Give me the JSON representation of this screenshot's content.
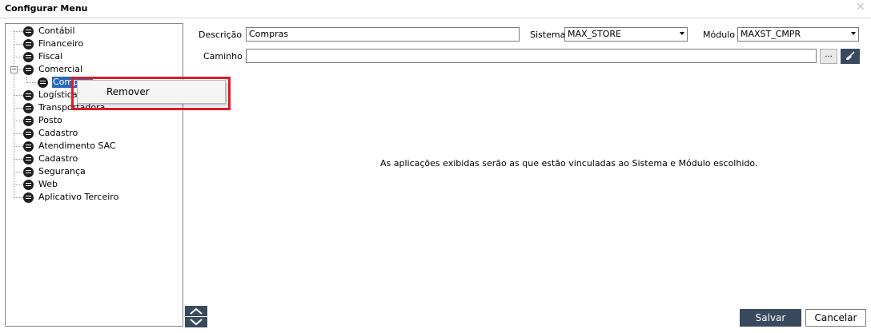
{
  "window": {
    "title": "Configurar Menu",
    "close_icon": "close-icon"
  },
  "tree": {
    "items": [
      {
        "label": "Contábil"
      },
      {
        "label": "Financeiro"
      },
      {
        "label": "Fiscal"
      },
      {
        "label": "Comercial",
        "expanded": true
      },
      {
        "label": "Compras",
        "selected": true
      },
      {
        "label": "Logística"
      },
      {
        "label": "Transportadora"
      },
      {
        "label": "Posto"
      },
      {
        "label": "Cadastro"
      },
      {
        "label": "Atendimento SAC"
      },
      {
        "label": "Cadastro"
      },
      {
        "label": "Segurança"
      },
      {
        "label": "Web"
      },
      {
        "label": "Aplicativo Terceiro"
      }
    ]
  },
  "context_menu": {
    "items": [
      {
        "label": "Remover"
      }
    ],
    "highlight_color": "#e01b24"
  },
  "form": {
    "descricao_label": "Descrição",
    "descricao_value": "Compras",
    "sistema_label": "Sistema",
    "sistema_value": "MAX_STORE",
    "modulo_label": "Módulo",
    "modulo_value": "MAXST_CMPR",
    "caminho_label": "Caminho",
    "caminho_value": "",
    "browse_label": "..."
  },
  "info_text": "As aplicações exibidas serão as que estão vinculadas ao Sistema e Módulo escolhido.",
  "buttons": {
    "save": "Salvar",
    "cancel": "Cancelar"
  },
  "colors": {
    "accent": "#3a4a5e",
    "selection": "#2a6ab8"
  }
}
